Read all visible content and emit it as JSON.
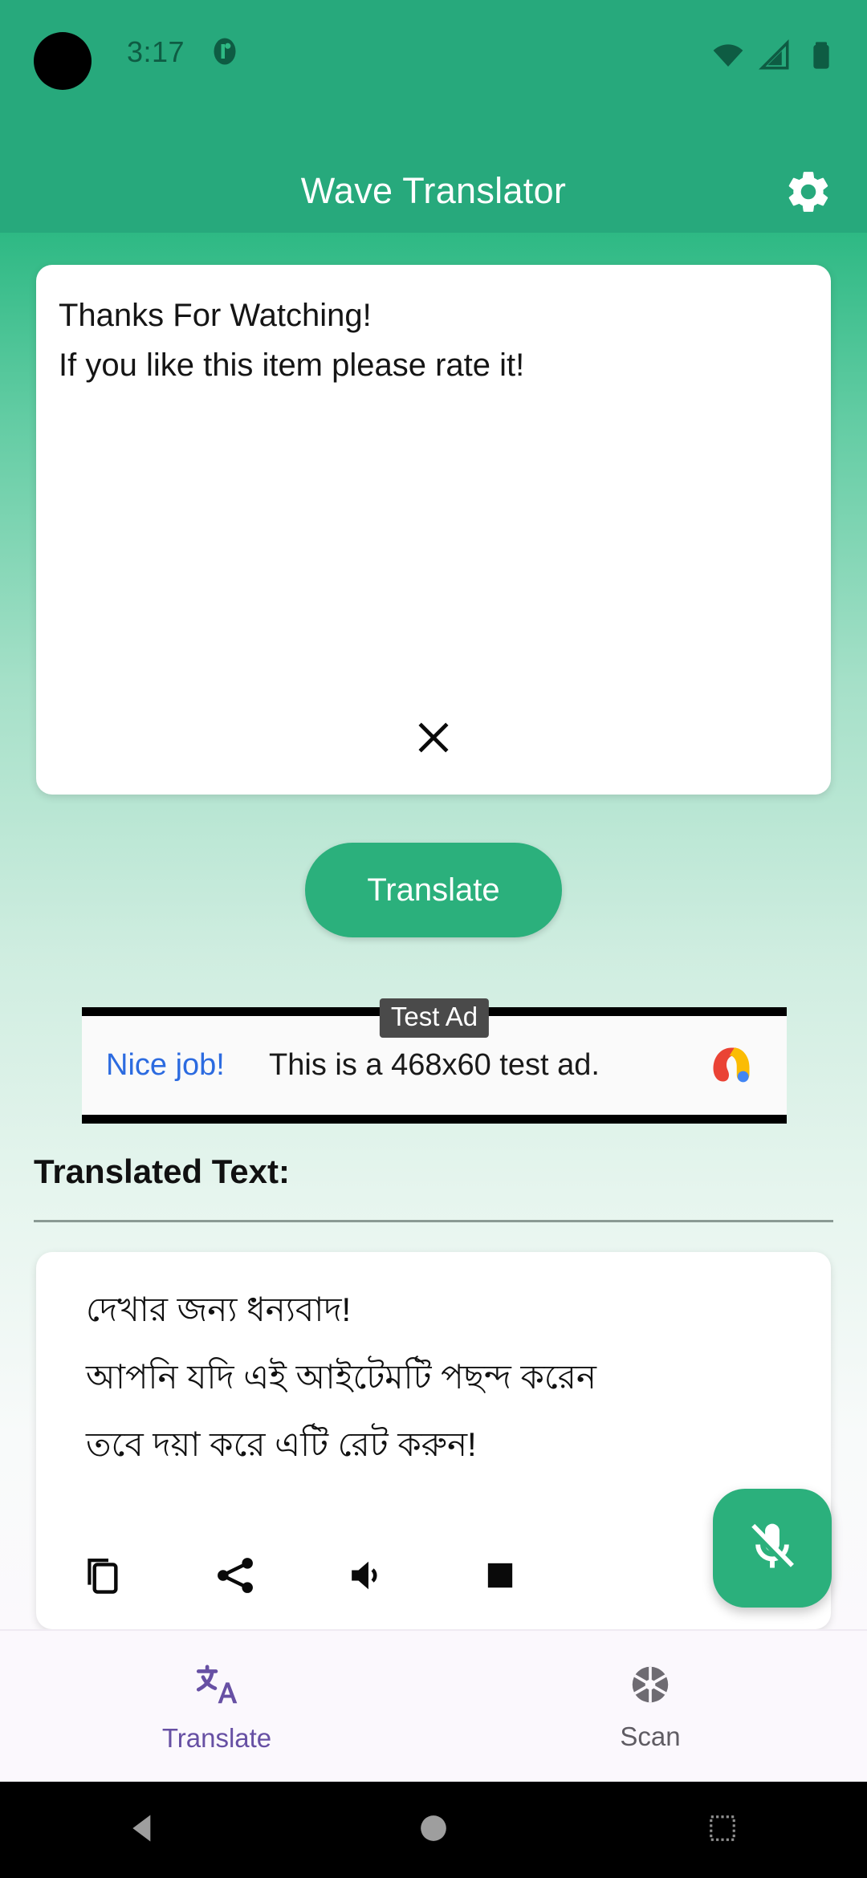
{
  "status_bar": {
    "time": "3:17",
    "notification_icon": "notification-dot-icon",
    "wifi_icon": "wifi-icon",
    "signal_icon": "cellular-signal-icon",
    "battery_icon": "battery-full-icon",
    "icon_color": "#0E5C43"
  },
  "app_bar": {
    "title": "Wave Translator",
    "settings_icon": "gear-icon",
    "background_color": "#27A97C",
    "title_color": "#FFFFFF"
  },
  "input_card": {
    "text": "Thanks For Watching!\nIf you like this item please rate it!",
    "clear_icon": "close-icon"
  },
  "translate_button": {
    "label": "Translate",
    "color": "#2BB07C"
  },
  "ad": {
    "badge": "Test Ad",
    "left_text": "Nice job!",
    "main_text": "This is a 468x60 test ad.",
    "left_text_color": "#2C6BE0",
    "logo_icon": "admob-logo-icon"
  },
  "output_section": {
    "label": "Translated Text:",
    "text": "দেখার জন্য ধন্যবাদ!\nআপনি যদি এই আইটেমটি পছন্দ করেন\nতবে দয়া করে এটি রেট করুন!",
    "actions": [
      {
        "name": "copy-icon"
      },
      {
        "name": "share-icon"
      },
      {
        "name": "speaker-icon"
      },
      {
        "name": "stop-icon"
      }
    ]
  },
  "mic_fab": {
    "icon": "mic-off-icon",
    "color": "#2BB07C"
  },
  "bottom_nav": {
    "active_color": "#6750A4",
    "inactive_color": "#5F5C63",
    "items": [
      {
        "label": "Translate",
        "icon": "translate-icon",
        "active": true
      },
      {
        "label": "Scan",
        "icon": "camera-aperture-icon",
        "active": false
      }
    ]
  },
  "android_nav": {
    "back_icon": "back-triangle-icon",
    "home_icon": "home-circle-icon",
    "recents_icon": "recents-square-icon"
  }
}
